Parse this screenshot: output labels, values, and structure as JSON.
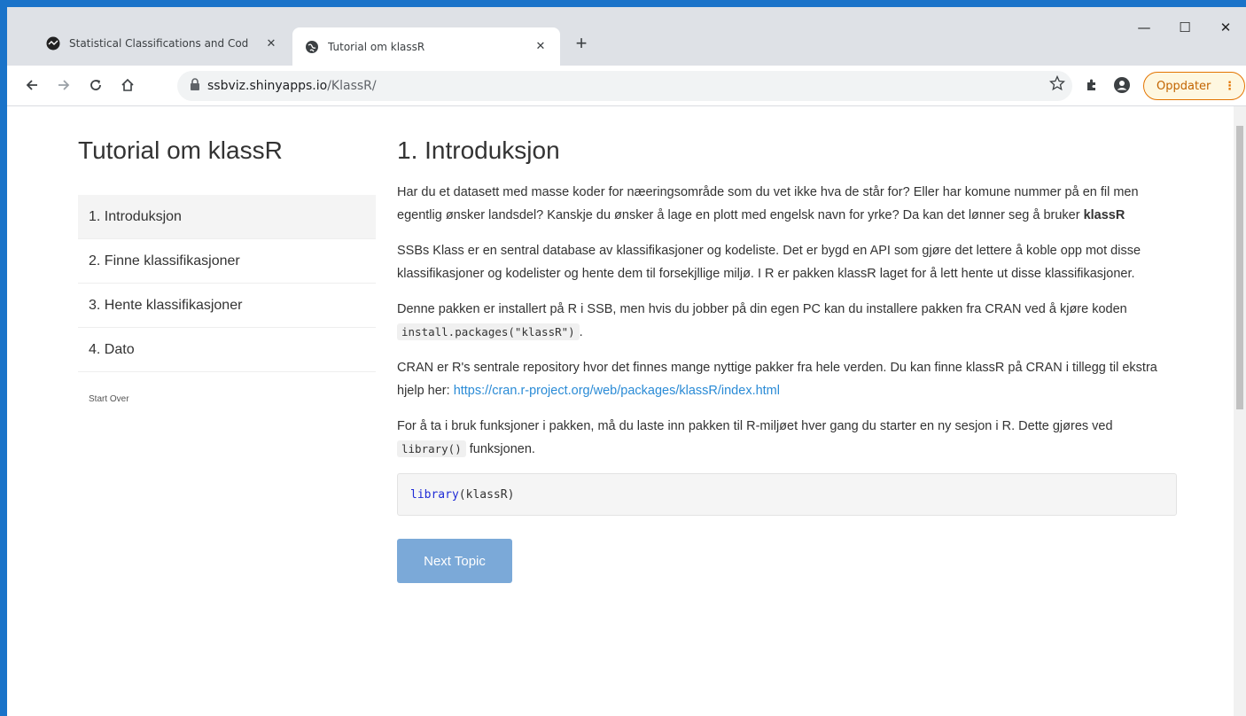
{
  "browser": {
    "tabs": [
      {
        "title": "Statistical Classifications and Cod",
        "close": "✕"
      },
      {
        "title": "Tutorial om klassR",
        "close": "✕"
      }
    ],
    "new_tab": "+",
    "url_host": "ssbviz.shinyapps.io",
    "url_path": "/KlassR/",
    "update_label": "Oppdater",
    "update_dots": "⋮",
    "window_controls": {
      "minimize": "—",
      "maximize": "☐",
      "close": "✕"
    },
    "icons": [
      "back-icon",
      "forward-icon",
      "reload-icon",
      "home-icon",
      "lock-icon",
      "star-icon",
      "extensions-icon",
      "profile-icon"
    ]
  },
  "sidebar": {
    "title": "Tutorial om klassR",
    "items": [
      {
        "label": "1. Introduksjon",
        "active": true
      },
      {
        "label": "2. Finne klassifikasjoner",
        "active": false
      },
      {
        "label": "3. Hente klassifikasjoner",
        "active": false
      },
      {
        "label": "4. Dato",
        "active": false
      }
    ],
    "start_over": "Start Over"
  },
  "content": {
    "heading": "1. Introduksjon",
    "p1_text": "Har du et datasett med masse koder for næeringsområde som du vet ikke hva de står for? Eller har komune nummer på en fil men egentlig ønsker landsdel? Kanskje du ønsker å lage en plott med engelsk navn for yrke? Da kan det lønner seg å bruker ",
    "p1_bold": "klassR",
    "p2": "SSBs Klass er en sentral database av klassifikasjoner og kodeliste. Det er bygd en API som gjøre det lettere å koble opp mot disse klassifikasjoner og kodelister og hente dem til forsekjllige miljø. I R er pakken klassR laget for å lett hente ut disse klassifikasjoner.",
    "p3_text": "Denne pakken er installert på R i SSB, men hvis du jobber på din egen PC kan du installere pakken fra CRAN ved å kjøre koden ",
    "p3_code": "install.packages(\"klassR\")",
    "p3_end": ".",
    "p4_text": "CRAN er R's sentrale repository hvor det finnes mange nyttige pakker fra hele verden. Du kan finne klassR på CRAN i tillegg til ekstra hjelp her: ",
    "p4_link": "https://cran.r-project.org/web/packages/klassR/index.html",
    "p5_text": "For å ta i bruk funksjoner i pakken, må du laste inn pakken til R-miljøet hver gang du starter en ny sesjon i R. Dette gjøres ved ",
    "p5_code": "library()",
    "p5_end": " funksjonen.",
    "code_fn": "library",
    "code_args": "(klassR)",
    "next_button": "Next Topic"
  }
}
